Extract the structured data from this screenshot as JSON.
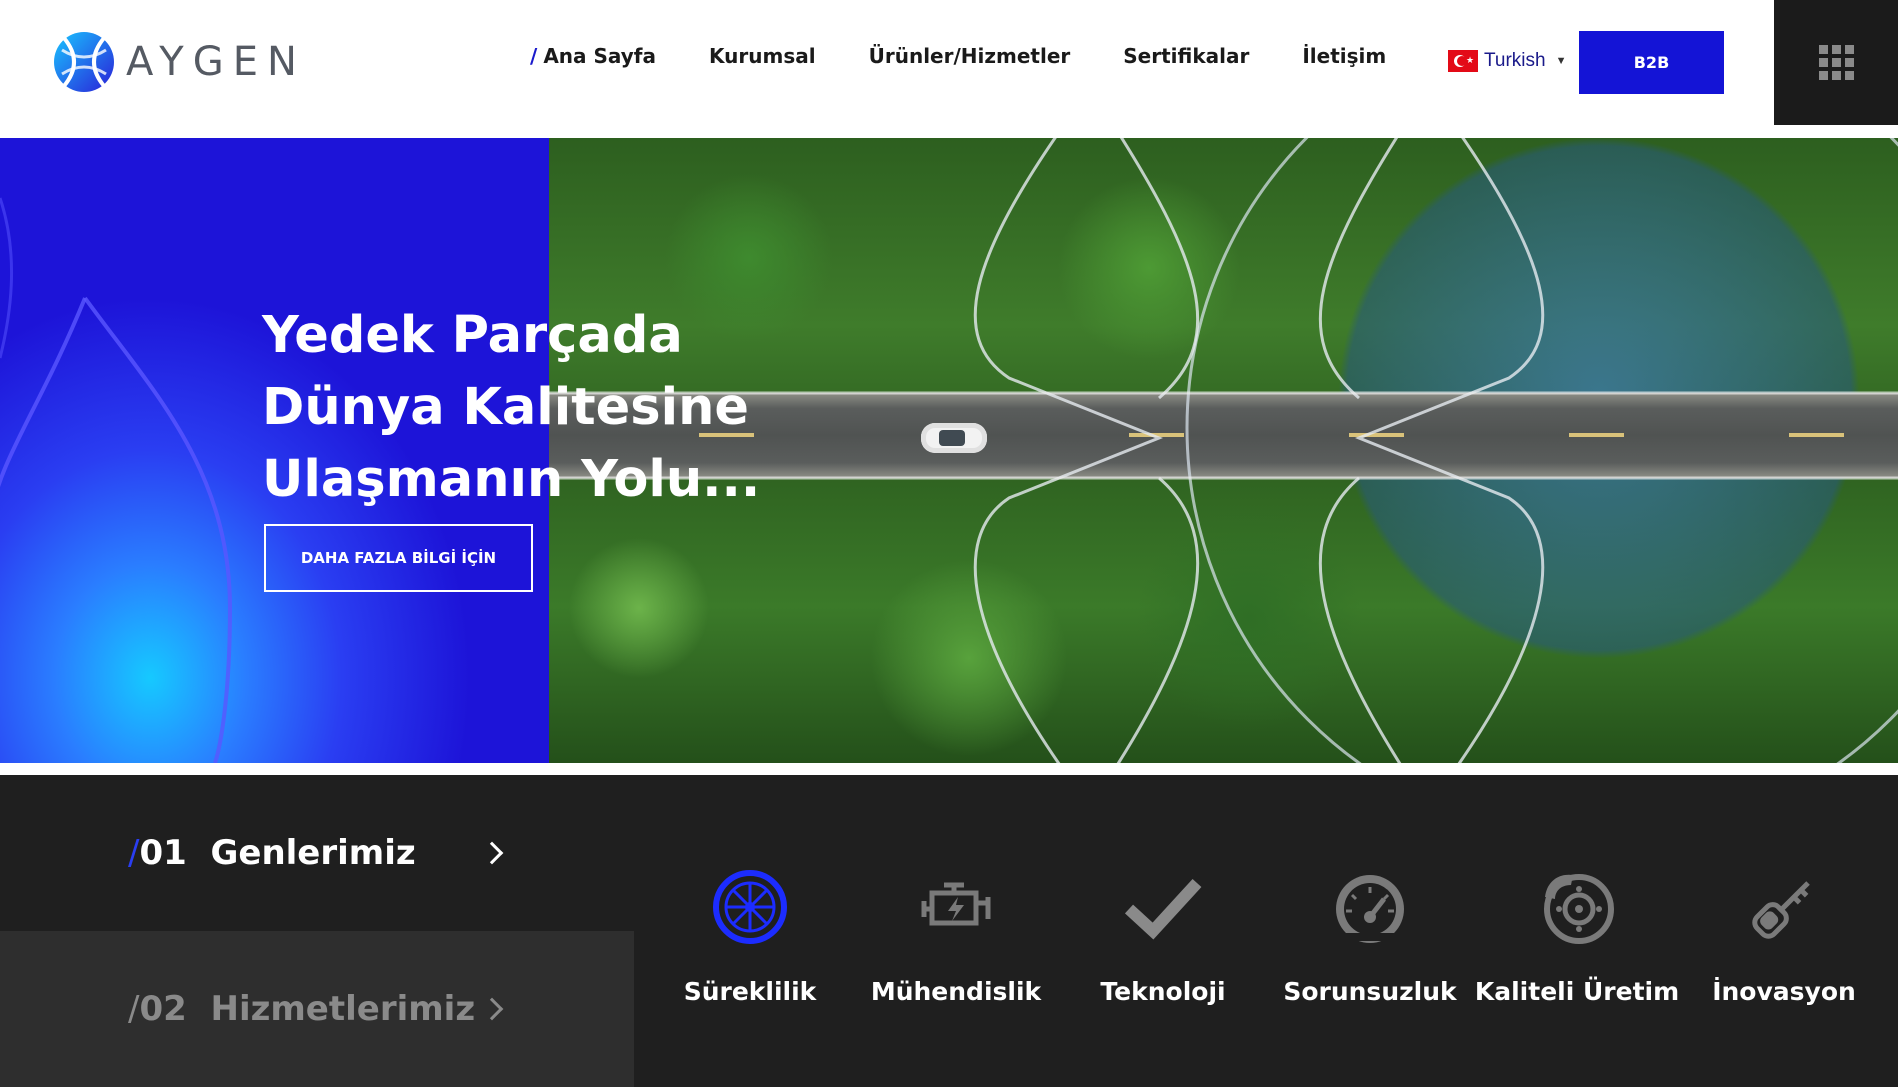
{
  "header": {
    "logo_text": "AYGEN",
    "nav": [
      {
        "label": "Ana Sayfa",
        "active": true
      },
      {
        "label": "Kurumsal",
        "active": false
      },
      {
        "label": "Ürünler/Hizmetler",
        "active": false
      },
      {
        "label": "Sertifikalar",
        "active": false
      },
      {
        "label": "İletişim",
        "active": false
      }
    ],
    "language": "Turkish",
    "b2b_label": "B2B"
  },
  "hero": {
    "title_lines": [
      "Yedek Parçada",
      "Dünya Kalitesine",
      "Ulaşmanın Yolu..."
    ],
    "cta_label": "DAHA FAZLA BİLGİ İÇİN"
  },
  "bottom": {
    "tabs": [
      {
        "number": "01",
        "label": "Genlerimiz"
      },
      {
        "number": "02",
        "label": "Hizmetlerimiz"
      }
    ],
    "features": [
      {
        "label": "Süreklilik",
        "icon": "wheel-icon",
        "highlight": true
      },
      {
        "label": "Mühendislik",
        "icon": "engine-icon",
        "highlight": false
      },
      {
        "label": "Teknoloji",
        "icon": "checkmark-icon",
        "highlight": false
      },
      {
        "label": "Sorunsuzluk",
        "icon": "speedometer-icon",
        "highlight": false
      },
      {
        "label": "Kaliteli Üretim",
        "icon": "brake-disc-icon",
        "highlight": false
      },
      {
        "label": "İnovasyon",
        "icon": "car-key-icon",
        "highlight": false
      }
    ]
  },
  "colors": {
    "brand_blue": "#1414d6",
    "dark_bg": "#1f1f1f",
    "tab_inactive_bg": "#2e2e2e"
  }
}
